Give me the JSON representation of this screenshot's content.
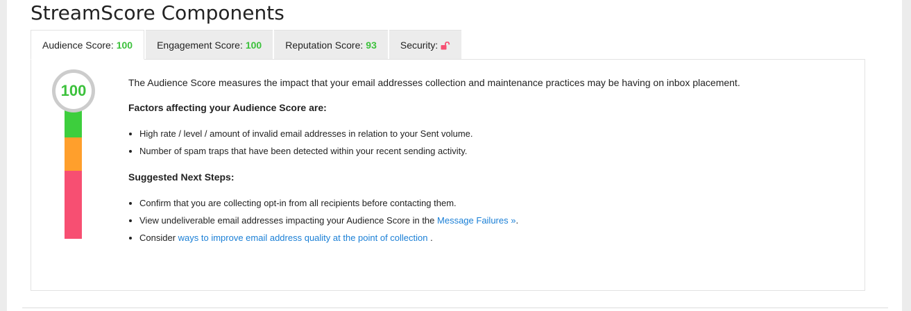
{
  "page": {
    "title": "StreamScore Components"
  },
  "tabs": [
    {
      "label": "Audience Score:",
      "score": "100"
    },
    {
      "label": "Engagement Score:",
      "score": "100"
    },
    {
      "label": "Reputation Score:",
      "score": "93"
    },
    {
      "label": "Security:",
      "icon": "unlock-icon"
    }
  ],
  "gauge": {
    "value": "100",
    "colors": {
      "ring": "#cccccc",
      "value": "#3cc13c",
      "green": "#3dce3d",
      "orange": "#ff9f2c",
      "red": "#f74f72"
    }
  },
  "content": {
    "intro": "The Audience Score measures the impact that your email addresses collection and maintenance practices may be having on inbox placement.",
    "factors_heading": "Factors affecting your Audience Score are:",
    "factors": [
      "High rate / level / amount of invalid email addresses in relation to your Sent volume.",
      "Number of spam traps that have been detected within your recent sending activity."
    ],
    "steps_heading": "Suggested Next Steps:",
    "step1": "Confirm that you are collecting opt-in from all recipients before contacting them.",
    "step2_pre": "View undeliverable email addresses impacting your Audience Score in the ",
    "step2_link": "Message Failures »",
    "step2_post": ".",
    "step3_pre": "Consider ",
    "step3_link": "ways to improve email address quality at the point of collection",
    "step3_post": " ."
  }
}
